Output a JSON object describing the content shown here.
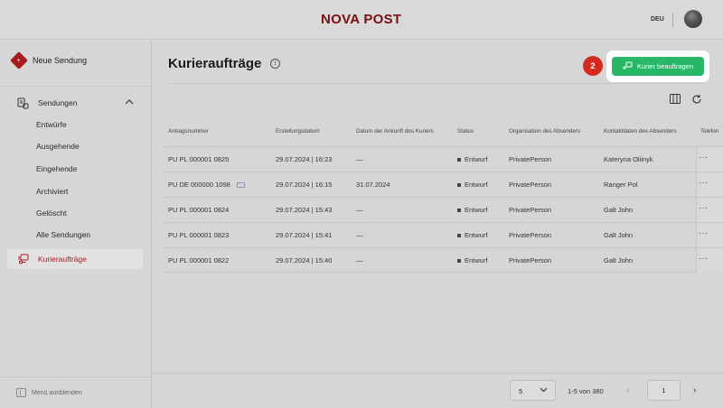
{
  "header": {
    "logo": "NOVA POST",
    "language": "DEU"
  },
  "sidebar": {
    "new_shipment": "Neue Sendung",
    "sendungen": "Sendungen",
    "sub_items": [
      "Entwürfe",
      "Ausgehende",
      "Eingehende",
      "Archiviert",
      "Gelöscht",
      "Alle Sendungen"
    ],
    "courier_orders": "Kurieraufträge",
    "collapse_menu": "Menü ausblenden"
  },
  "main": {
    "title": "Kurieraufträge",
    "info_icon": "i",
    "step_number": "2",
    "order_courier_button": "Kurier beauftragen"
  },
  "table": {
    "columns": [
      "Antragsnummer",
      "Erstellungsdatum",
      "Datum der Ankunft des Kuriers",
      "Status",
      "Organisation des Absenders",
      "Kontaktdaten des Absenders",
      "Telefon"
    ],
    "rows": [
      {
        "number": "PU PL 000001 0825",
        "created": "29.07.2024 | 16:23",
        "arrival": "—",
        "status": "Entwurf",
        "org": "PrivatePerson",
        "contact": "Kateryna Oliinyk"
      },
      {
        "number": "PU DE 000000 1098",
        "created": "29.07.2024 | 16:15",
        "arrival": "31.07.2024",
        "status": "Entwurf",
        "org": "PrivatePerson",
        "contact": "Ranger Pol"
      },
      {
        "number": "PU PL 000001 0824",
        "created": "29.07.2024 | 15:43",
        "arrival": "—",
        "status": "Entwurf",
        "org": "PrivatePerson",
        "contact": "Galt John"
      },
      {
        "number": "PU PL 000001 0823",
        "created": "29.07.2024 | 15:41",
        "arrival": "—",
        "status": "Entwurf",
        "org": "PrivatePerson",
        "contact": "Galt John"
      },
      {
        "number": "PU PL 000001 0822",
        "created": "29.07.2024 | 15:40",
        "arrival": "—",
        "status": "Entwurf",
        "org": "PrivatePerson",
        "contact": "Galt John"
      }
    ],
    "row_menu": "···"
  },
  "pagination": {
    "per_page": "5",
    "range": "1-5 von 380",
    "page": "1",
    "prev": "‹",
    "next": "›"
  },
  "colors": {
    "brand": "#a9191e",
    "cta": "#27b766",
    "badge": "#d42a20"
  }
}
